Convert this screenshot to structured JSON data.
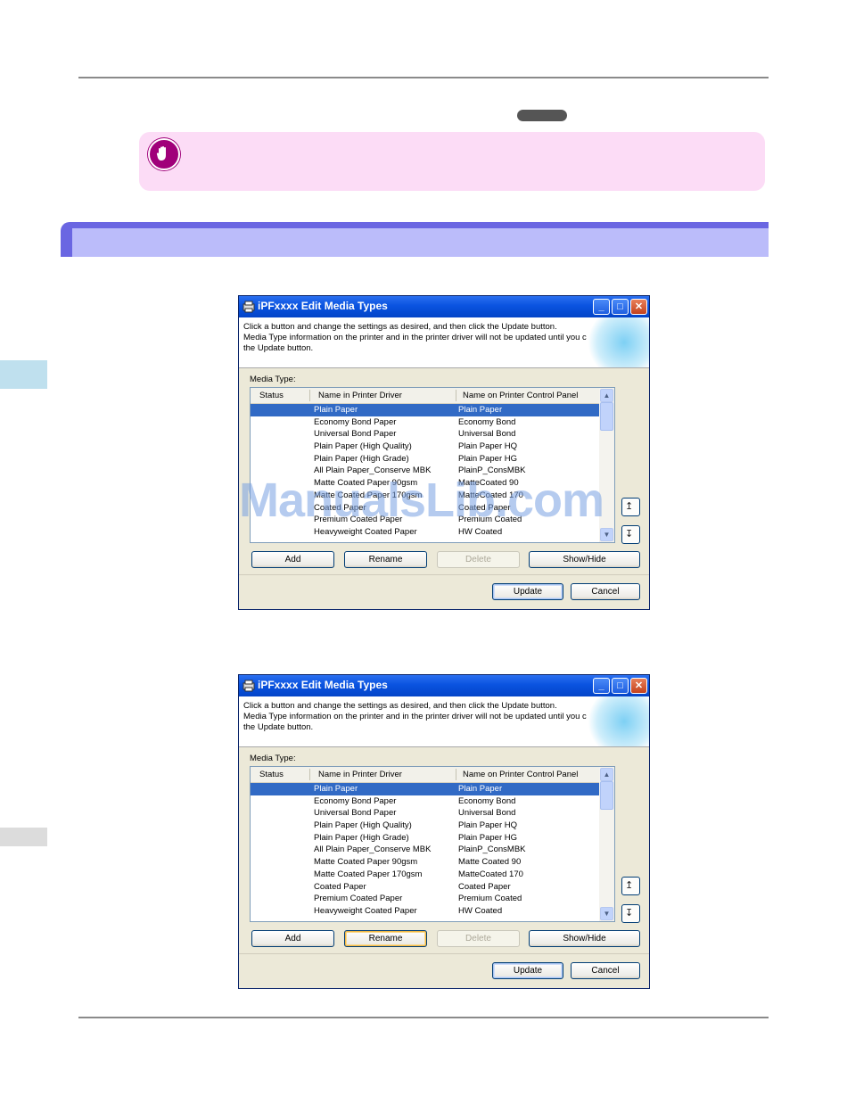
{
  "watermark": "ManualsLib.com",
  "dialogs": [
    {
      "title": "iPFxxxx Edit Media Types",
      "banner_lines": [
        "Click a button and change the settings as desired, and then click the Update button.",
        "Media Type information on the printer and in the printer driver will not be updated until you click",
        "the Update button."
      ],
      "media_type_label": "Media Type:",
      "columns": [
        "Status",
        "Name in Printer Driver",
        "Name on Printer Control Panel"
      ],
      "rows": [
        {
          "status": "",
          "driver": "Plain Paper",
          "panel": "Plain Paper",
          "selected": true
        },
        {
          "status": "",
          "driver": "Economy Bond Paper",
          "panel": "Economy Bond"
        },
        {
          "status": "",
          "driver": "Universal Bond Paper",
          "panel": "Universal Bond"
        },
        {
          "status": "",
          "driver": "Plain Paper (High Quality)",
          "panel": "Plain Paper HQ"
        },
        {
          "status": "",
          "driver": "Plain Paper (High Grade)",
          "panel": "Plain Paper HG"
        },
        {
          "status": "",
          "driver": "All Plain Paper_Conserve MBK",
          "panel": "PlainP_ConsMBK"
        },
        {
          "status": "",
          "driver": "Matte Coated Paper 90gsm",
          "panel": "MatteCoated 90"
        },
        {
          "status": "",
          "driver": "Matte Coated Paper 170gsm",
          "panel": "MatteCoated 170"
        },
        {
          "status": "",
          "driver": "Coated Paper",
          "panel": "Coated Paper"
        },
        {
          "status": "",
          "driver": "Premium Coated Paper",
          "panel": "Premium Coated"
        },
        {
          "status": "",
          "driver": "Heavyweight Coated Paper",
          "panel": "HW Coated"
        }
      ],
      "buttons": {
        "add": "Add",
        "rename": "Rename",
        "delete": "Delete",
        "show_hide": "Show/Hide",
        "update": "Update",
        "cancel": "Cancel"
      },
      "title_buttons": {
        "minimize": "_",
        "maximize": "□",
        "close": "✕"
      },
      "side_buttons": {
        "up": "↥",
        "down": "↧"
      }
    },
    {
      "title": "iPFxxxx Edit Media Types",
      "banner_lines": [
        "Click a button and change the settings as desired, and then click the Update button.",
        "Media Type information on the printer and in the printer driver will not be updated until you click",
        "the Update button."
      ],
      "media_type_label": "Media Type:",
      "columns": [
        "Status",
        "Name in Printer Driver",
        "Name on Printer Control Panel"
      ],
      "rows": [
        {
          "status": "",
          "driver": "Plain Paper",
          "panel": "Plain Paper",
          "selected": true
        },
        {
          "status": "",
          "driver": "Economy Bond Paper",
          "panel": "Economy Bond"
        },
        {
          "status": "",
          "driver": "Universal Bond Paper",
          "panel": "Universal Bond"
        },
        {
          "status": "",
          "driver": "Plain Paper (High Quality)",
          "panel": "Plain Paper HQ"
        },
        {
          "status": "",
          "driver": "Plain Paper (High Grade)",
          "panel": "Plain Paper HG"
        },
        {
          "status": "",
          "driver": "All Plain Paper_Conserve MBK",
          "panel": "PlainP_ConsMBK"
        },
        {
          "status": "",
          "driver": "Matte Coated Paper 90gsm",
          "panel": "Matte Coated 90"
        },
        {
          "status": "",
          "driver": "Matte Coated Paper 170gsm",
          "panel": "MatteCoated 170"
        },
        {
          "status": "",
          "driver": "Coated Paper",
          "panel": "Coated Paper"
        },
        {
          "status": "",
          "driver": "Premium Coated Paper",
          "panel": "Premium Coated"
        },
        {
          "status": "",
          "driver": "Heavyweight Coated Paper",
          "panel": "HW Coated"
        }
      ],
      "buttons": {
        "add": "Add",
        "rename": "Rename",
        "delete": "Delete",
        "show_hide": "Show/Hide",
        "update": "Update",
        "cancel": "Cancel"
      },
      "title_buttons": {
        "minimize": "_",
        "maximize": "□",
        "close": "✕"
      },
      "side_buttons": {
        "up": "↥",
        "down": "↧"
      }
    }
  ]
}
